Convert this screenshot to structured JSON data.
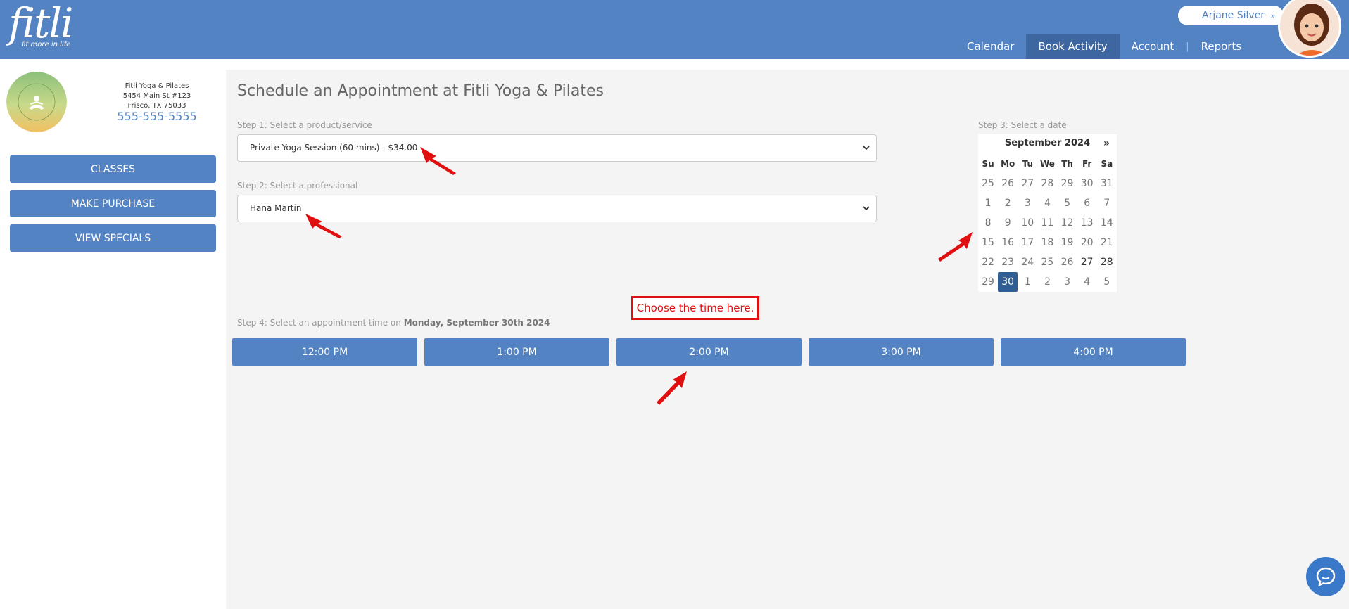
{
  "brand": {
    "logo_word": "fitli",
    "tagline": "fit more in life"
  },
  "user": {
    "name": "Arjane Silver",
    "chevron": "»"
  },
  "nav": {
    "items": [
      {
        "label": "Calendar"
      },
      {
        "label": "Book Activity"
      },
      {
        "label": "Account"
      },
      {
        "label": "Reports"
      }
    ],
    "active": "Book Activity",
    "separator": "|"
  },
  "org": {
    "logo_text": "FITLI YOGA & PILATES",
    "name": "Fitli Yoga & Pilates",
    "address_line1": "5454 Main St #123",
    "address_line2": "Frisco, TX 75033",
    "phone": "555-555-5555"
  },
  "sidebar": {
    "buttons": [
      {
        "label": "CLASSES"
      },
      {
        "label": "MAKE PURCHASE"
      },
      {
        "label": "VIEW SPECIALS"
      }
    ]
  },
  "main": {
    "title": "Schedule an Appointment at Fitli Yoga & Pilates",
    "step1": {
      "label": "Step 1: Select a product/service",
      "value": "Private Yoga Session (60 mins) - $34.00"
    },
    "step2": {
      "label": "Step 2: Select a professional",
      "value": "Hana Martin"
    },
    "step3": {
      "label": "Step 3: Select a date"
    },
    "step4": {
      "label_prefix": "Step 4: Select an appointment time on ",
      "date": "Monday, September 30th 2024"
    },
    "callout": "Choose the time here.",
    "times": [
      "12:00 PM",
      "1:00 PM",
      "2:00 PM",
      "3:00 PM",
      "4:00 PM"
    ]
  },
  "calendar": {
    "month_label": "September 2024",
    "next_label": "»",
    "weekdays": [
      "Su",
      "Mo",
      "Tu",
      "We",
      "Th",
      "Fr",
      "Sa"
    ],
    "weeks": [
      [
        "25",
        "26",
        "27",
        "28",
        "29",
        "30",
        "31"
      ],
      [
        "1",
        "2",
        "3",
        "4",
        "5",
        "6",
        "7"
      ],
      [
        "8",
        "9",
        "10",
        "11",
        "12",
        "13",
        "14"
      ],
      [
        "15",
        "16",
        "17",
        "18",
        "19",
        "20",
        "21"
      ],
      [
        "22",
        "23",
        "24",
        "25",
        "26",
        "27",
        "28"
      ],
      [
        "29",
        "30",
        "1",
        "2",
        "3",
        "4",
        "5"
      ]
    ],
    "selected": "30"
  },
  "colors": {
    "brand_blue": "#5383c3",
    "nav_active": "#3e66a0",
    "selected_day": "#2f5e92",
    "annotation_red": "#e01010"
  },
  "icons": {
    "dropdown": "chevron-down-icon",
    "chat": "chat-bubble-icon"
  }
}
